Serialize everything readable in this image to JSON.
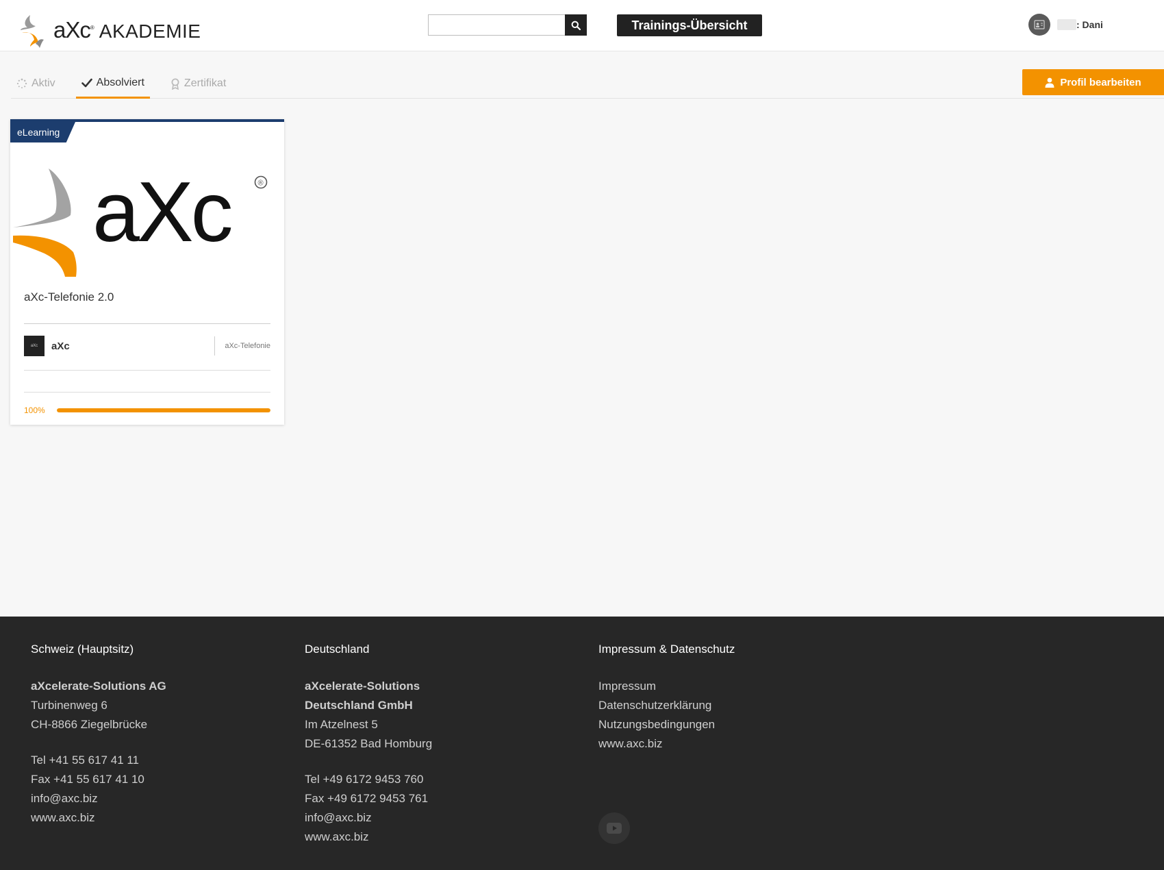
{
  "header": {
    "logo_brand": "aXc",
    "logo_reg": "®",
    "logo_subtitle": "AKADEMIE",
    "search_placeholder": "",
    "overview_button": "Trainings-Übersicht",
    "user_name": ": Dani"
  },
  "tabs": [
    {
      "label": "Aktiv",
      "icon": "spinner-icon",
      "active": false
    },
    {
      "label": "Absolviert",
      "icon": "check-icon",
      "active": true
    },
    {
      "label": "Zertifikat",
      "icon": "award-icon",
      "active": false
    }
  ],
  "profile_button": "Profil bearbeiten",
  "card": {
    "badge": "eLearning",
    "image_brand": "aXc",
    "title": "aXc-Telefonie 2.0",
    "provider": "aXc",
    "provider_logo_text": "aXc",
    "category": "aXc-Telefonie",
    "progress_label": "100%",
    "progress": 1.0
  },
  "footer": {
    "col1": {
      "heading": "Schweiz (Hauptsitz)",
      "company": "aXcelerate-Solutions AG",
      "street": "Turbinenweg 6",
      "city": "CH-8866 Ziegelbrücke",
      "tel": "Tel +41 55 617 41 11",
      "fax": "Fax +41 55 617 41 10",
      "email": "info@axc.biz",
      "web": "www.axc.biz"
    },
    "col2": {
      "heading": "Deutschland",
      "company_line1": "aXcelerate-Solutions",
      "company_line2": "Deutschland GmbH",
      "street": "Im Atzelnest 5",
      "city": "DE-61352 Bad Homburg",
      "tel": "Tel +49 6172 9453 760",
      "fax": "Fax +49 6172 9453 761",
      "email": "info@axc.biz",
      "web": "www.axc.biz"
    },
    "col3": {
      "heading": "Impressum & Datenschutz",
      "links": [
        "Impressum",
        "Datenschutzerklärung",
        "Nutzungsbedingungen",
        "www.axc.biz"
      ]
    }
  },
  "colors": {
    "accent": "#f39200",
    "navy": "#1c3d6e",
    "dark": "#222222",
    "footer_bg": "#272727"
  }
}
